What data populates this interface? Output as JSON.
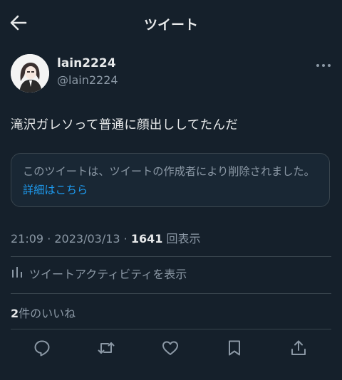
{
  "header": {
    "title": "ツイート"
  },
  "author": {
    "display_name": "lain2224",
    "handle": "@lain2224"
  },
  "tweet": {
    "text": "滝沢ガレソって普通に顔出ししてたんだ"
  },
  "notice": {
    "message": "このツイートは、ツイートの作成者により削除されました。",
    "link": "詳細はこちら"
  },
  "meta": {
    "time": "21:09",
    "date": "2023/03/13",
    "views_count": "1641",
    "views_label": "回表示"
  },
  "activity": {
    "label": "ツイートアクティビティを表示"
  },
  "likes": {
    "count": "2",
    "label": "件のいいね"
  },
  "colors": {
    "background": "#15202b",
    "link": "#1d9bf0",
    "muted": "#8b98a5",
    "border": "#38444d"
  },
  "icons": [
    "back-arrow-icon",
    "more-icon",
    "bar-chart-icon",
    "reply-icon",
    "retweet-icon",
    "like-icon",
    "bookmark-icon",
    "share-icon"
  ]
}
